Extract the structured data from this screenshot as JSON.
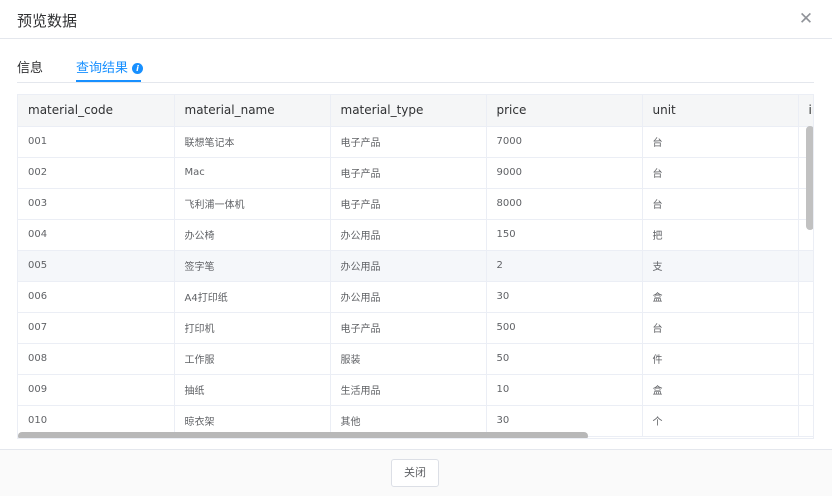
{
  "dialog": {
    "title": "预览数据",
    "close_glyph": "✕"
  },
  "tabs": [
    {
      "label": "信息"
    },
    {
      "label": "查询结果",
      "active": true,
      "info_glyph": "i"
    }
  ],
  "table": {
    "columns": [
      "material_code",
      "material_name",
      "material_type",
      "price",
      "unit",
      "in"
    ],
    "rows": [
      [
        "001",
        "联想笔记本",
        "电子产品",
        "7000",
        "台",
        ""
      ],
      [
        "002",
        "Mac",
        "电子产品",
        "9000",
        "台",
        ""
      ],
      [
        "003",
        "飞利浦一体机",
        "电子产品",
        "8000",
        "台",
        ""
      ],
      [
        "004",
        "办公椅",
        "办公用品",
        "150",
        "把",
        ""
      ],
      [
        "005",
        "签字笔",
        "办公用品",
        "2",
        "支",
        ""
      ],
      [
        "006",
        "A4打印纸",
        "办公用品",
        "30",
        "盒",
        ""
      ],
      [
        "007",
        "打印机",
        "电子产品",
        "500",
        "台",
        ""
      ],
      [
        "008",
        "工作服",
        "服装",
        "50",
        "件",
        ""
      ],
      [
        "009",
        "抽纸",
        "生活用品",
        "10",
        "盒",
        ""
      ],
      [
        "010",
        "晾衣架",
        "其他",
        "30",
        "个",
        ""
      ]
    ],
    "highlighted_row_index": 4
  },
  "footer": {
    "close_label": "关闭"
  },
  "colors": {
    "accent": "#1890ff",
    "header_bg": "#f5f6f7",
    "row_highlight": "#f5f7fa"
  }
}
